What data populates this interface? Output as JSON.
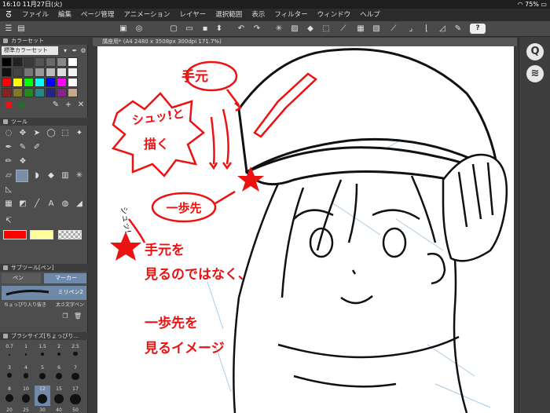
{
  "status_bar": {
    "time": "16:10",
    "date": "11月27日(火)",
    "battery": "75%"
  },
  "menu": {
    "items": [
      "ファイル",
      "編集",
      "ページ管理",
      "アニメーション",
      "レイヤー",
      "選択範囲",
      "表示",
      "フィルター",
      "ウィンドウ",
      "ヘルプ"
    ]
  },
  "toolbar": {
    "help_label": "?"
  },
  "color_set_panel": {
    "title": "カラーセット",
    "preset": "標準カラーセット"
  },
  "tool_panel": {
    "title": "ツール"
  },
  "sub_tool_panel": {
    "title": "サブツール[ペン]",
    "tab_pen": "ペン",
    "tab_marker": "マーカー",
    "brush_name": "ミリペン2",
    "brush_name_2": "ちょっぴり入り抜き",
    "brush_name_3": "太さ文字ペン"
  },
  "brush_size_panel": {
    "title": "ブラシサイズ[ちょっぴり...",
    "sizes": [
      "0.7",
      "1",
      "1.5",
      "2",
      "2.5",
      "3",
      "4",
      "5",
      "6",
      "7",
      "8",
      "10",
      "12",
      "15",
      "17",
      "20",
      "25",
      "30",
      "40",
      "50"
    ]
  },
  "document": {
    "tab_label": "講座用* (A4 2480 x 3508px 300dpi 171.7%)"
  },
  "annotations": {
    "hand": "手元",
    "shu_draw_1": "シュッ!と",
    "shu_draw_2": "描く",
    "shu_side": "シュッ!",
    "one_step": "一歩先",
    "note_line1": "手元を",
    "note_line2": "見るのではなく、",
    "note_line3": "一歩先を",
    "note_line4": "見るイメージ"
  },
  "colors": {
    "accent_red": "#ee1111",
    "main_color": "#ff0000",
    "sub_color": "#ffff99"
  }
}
